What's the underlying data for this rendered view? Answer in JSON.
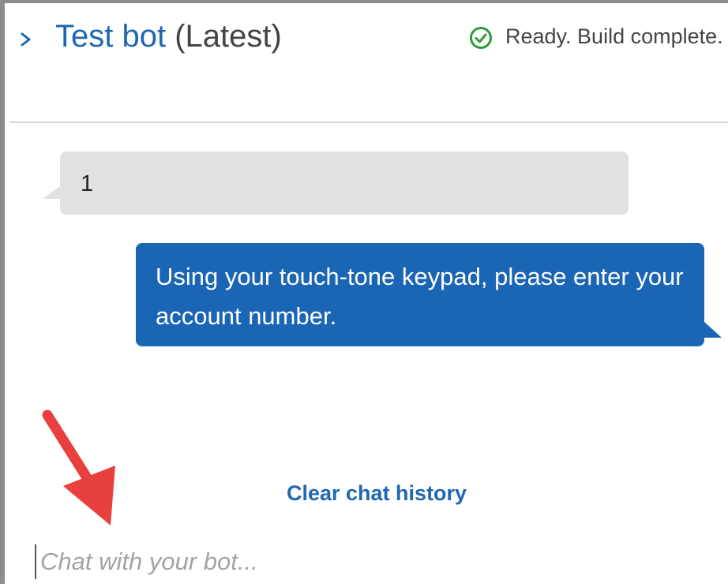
{
  "header": {
    "title_name": "Test bot",
    "title_version": "(Latest)",
    "status_text": "Ready. Build complete.",
    "status_icon": "check-circle-icon",
    "expand_icon": "chevron-right-icon"
  },
  "chat": {
    "messages": [
      {
        "from": "user",
        "text": "1"
      },
      {
        "from": "bot",
        "text": "Using your touch-tone keypad, please enter your account number."
      }
    ],
    "clear_label": "Clear chat history",
    "input_placeholder": "Chat with your bot...",
    "input_value": ""
  },
  "colors": {
    "accent": "#1f67b2",
    "bot_bubble": "#1b65b5",
    "user_bubble": "#e1e1e1",
    "status_ok": "#2e9c3a",
    "annotation_arrow": "#e8403f"
  }
}
